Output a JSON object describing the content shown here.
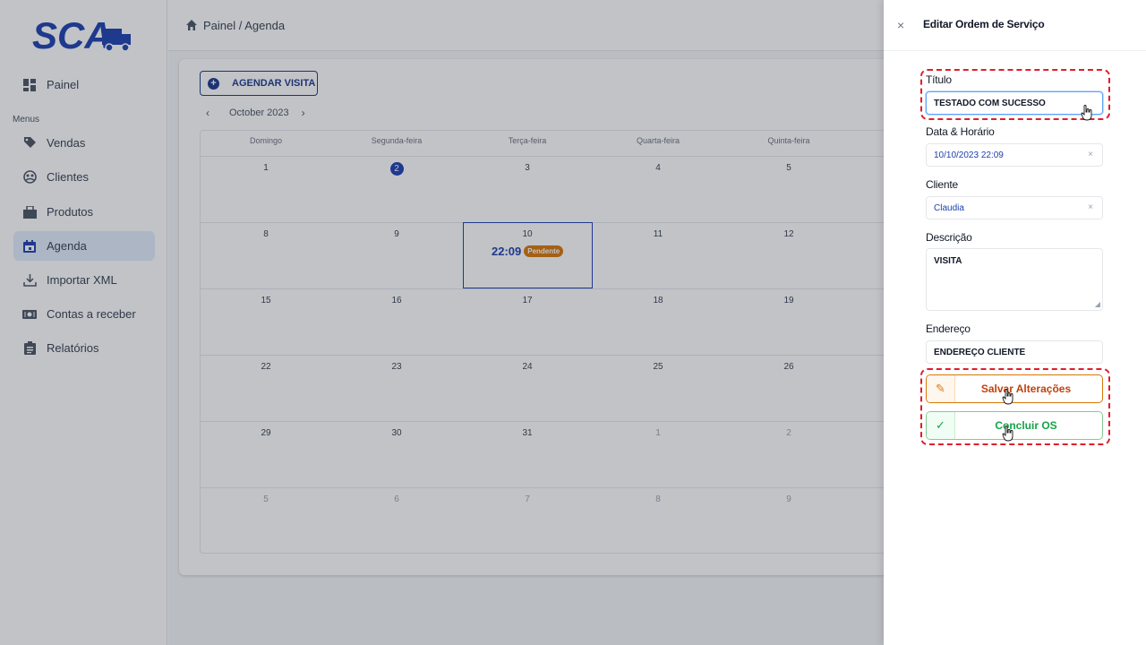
{
  "sidebar": {
    "logo_text": "SCA",
    "menus_label": "Menus",
    "items": [
      {
        "label": "Painel",
        "icon": "dashboard-icon"
      },
      {
        "label": "Vendas",
        "icon": "tag-icon"
      },
      {
        "label": "Clientes",
        "icon": "users-icon"
      },
      {
        "label": "Produtos",
        "icon": "box-icon"
      },
      {
        "label": "Agenda",
        "icon": "calendar-icon",
        "active": true
      },
      {
        "label": "Importar XML",
        "icon": "download-icon"
      },
      {
        "label": "Contas a receber",
        "icon": "money-icon"
      },
      {
        "label": "Relatórios",
        "icon": "clipboard-icon"
      }
    ]
  },
  "breadcrumb": {
    "text": "Painel / Agenda"
  },
  "toolbar": {
    "agendar_label": "AGENDAR VISITA"
  },
  "calendar": {
    "month": "October 2023",
    "prev": "‹",
    "next": "›",
    "weekdays": [
      "Domingo",
      "Segunda-feira",
      "Terça-feira",
      "Quarta-feira",
      "Quinta-feira"
    ],
    "weeks": [
      [
        "1",
        "2",
        "3",
        "4",
        "5"
      ],
      [
        "8",
        "9",
        "10",
        "11",
        "12"
      ],
      [
        "15",
        "16",
        "17",
        "18",
        "19"
      ],
      [
        "22",
        "23",
        "24",
        "25",
        "26"
      ],
      [
        "29",
        "30",
        "31",
        "1",
        "2"
      ],
      [
        "5",
        "6",
        "7",
        "8",
        "9"
      ]
    ],
    "event": {
      "time": "22:09",
      "status": "Pendente"
    }
  },
  "drawer": {
    "close": "×",
    "title": "Editar Ordem de Serviço",
    "titulo_label": "Título",
    "titulo_value": "TESTADO COM SUCESSO",
    "data_label": "Data & Horário",
    "data_value": "10/10/2023 22:09",
    "cliente_label": "Cliente",
    "cliente_value": "Claudia",
    "clear": "×",
    "descricao_label": "Descrição",
    "descricao_value": "VISITA",
    "endereco_label": "Endereço",
    "endereco_value": "ENDEREÇO CLIENTE",
    "save_label": "Salvar Alterações",
    "concluir_label": "Concluir OS",
    "save_icon": "✎",
    "concluir_icon": "✓"
  },
  "colors": {
    "brand": "#1e40af",
    "pending": "#d97706",
    "success": "#16a34a",
    "highlight": "#e11d2a"
  }
}
